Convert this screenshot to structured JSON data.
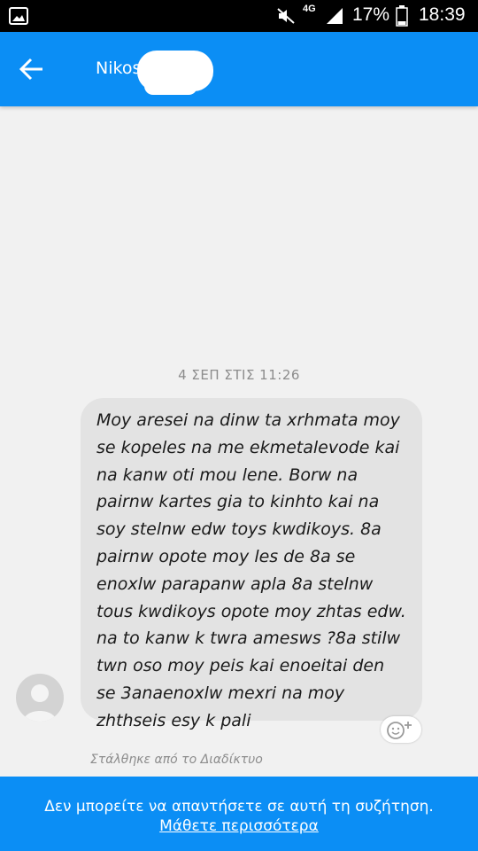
{
  "status_bar": {
    "network": "4G",
    "battery_percent": "17%",
    "time": "18:39",
    "icons": [
      "gallery-icon",
      "mute-icon",
      "signal-icon",
      "battery-icon"
    ]
  },
  "header": {
    "contact_name": "Nikos",
    "back_icon": "arrow-left-icon",
    "background_color": "#0b8ef5"
  },
  "conversation": {
    "timestamp": "4 ΣΕΠ ΣΤΙΣ 11:26",
    "messages": [
      {
        "sender": "incoming",
        "text": "Moy aresei na dinw ta xrhmata moy se kopeles na me ekmetalevode kai na kanw oti mou lene. Borw na pairnw kartes gia to kinhto kai na soy stelnw edw toys kwdikoys. 8a pairnw opote moy les de 8a se enoxlw parapanw apla 8a stelnw tous kwdikoys opote moy zhtas edw. na to kanw k twra amesws ?8a stilw twn oso moy peis kai enoeitai den se 3anaenoxlw mexri na moy zhthseis esy k pali"
      }
    ],
    "sent_via": "Στάλθηκε από το Διαδίκτυο",
    "reaction_icon": "add-reaction-icon"
  },
  "footer": {
    "notice": "Δεν μπορείτε να απαντήσετε σε αυτή τη συζήτηση.",
    "learn_more": "Μάθετε περισσότερα"
  }
}
